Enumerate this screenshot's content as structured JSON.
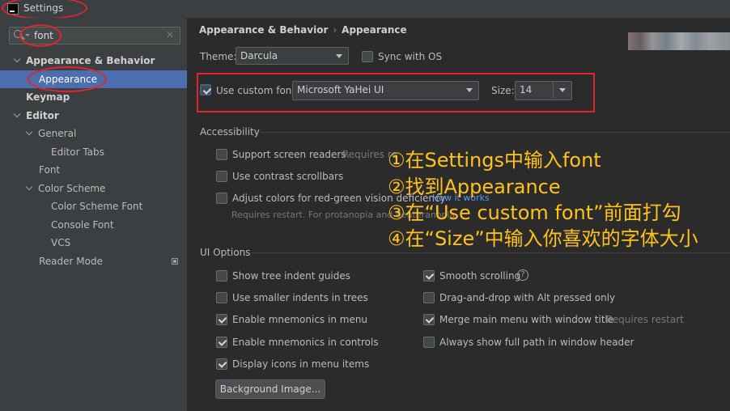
{
  "window": {
    "title": "Settings"
  },
  "search": {
    "value": "font"
  },
  "tree": [
    {
      "label": "Appearance & Behavior"
    },
    {
      "label": "Appearance"
    },
    {
      "label": "Keymap"
    },
    {
      "label": "Editor"
    },
    {
      "label": "General"
    },
    {
      "label": "Editor Tabs"
    },
    {
      "label": "Font"
    },
    {
      "label": "Color Scheme"
    },
    {
      "label": "Color Scheme Font"
    },
    {
      "label": "Console Font"
    },
    {
      "label": "VCS"
    },
    {
      "label": "Reader Mode"
    }
  ],
  "breadcrumb": {
    "parent": "Appearance & Behavior",
    "current": "Appearance"
  },
  "theme": {
    "label": "Theme:",
    "value": "Darcula",
    "sync_label": "Sync with OS",
    "sync_checked": false
  },
  "font": {
    "use_custom_label": "Use custom font:",
    "use_custom_checked": true,
    "family": "Microsoft YaHei UI",
    "size_label": "Size:",
    "size": "14"
  },
  "accessibility": {
    "title": "Accessibility",
    "screen_readers": "Support screen readers",
    "screen_readers_hint": "Requires re",
    "contrast_scrollbars": "Use contrast scrollbars",
    "adjust_colors": "Adjust colors for red-green vision deficiency",
    "how_it_works": "How it works",
    "adjust_hint": "Requires restart. For protanopia and deuteranopia"
  },
  "ui_options": {
    "title": "UI Options",
    "left": [
      {
        "label": "Show tree indent guides",
        "checked": false
      },
      {
        "label": "Use smaller indents in trees",
        "checked": false
      },
      {
        "label": "Enable mnemonics in menu",
        "checked": true
      },
      {
        "label": "Enable mnemonics in controls",
        "checked": true
      },
      {
        "label": "Display icons in menu items",
        "checked": true
      }
    ],
    "right": [
      {
        "label": "Smooth scrolling",
        "checked": true
      },
      {
        "label": "Drag-and-drop with Alt pressed only",
        "checked": false
      },
      {
        "label": "Merge main menu with window title",
        "checked": true
      },
      {
        "label": "Always show full path in window header",
        "checked": false
      }
    ],
    "merge_hint": "Requires restart",
    "background_button": "Background Image..."
  },
  "annotations": [
    "①在Settings中输入font",
    "②找到Appearance",
    "③在“Use custom font”前面打勾",
    "④在“Size”中输入你喜欢的字体大小"
  ],
  "colors": {
    "accent": "#4b6eaf",
    "annotation": "#ffc21a",
    "highlight_box": "#e0262a"
  }
}
